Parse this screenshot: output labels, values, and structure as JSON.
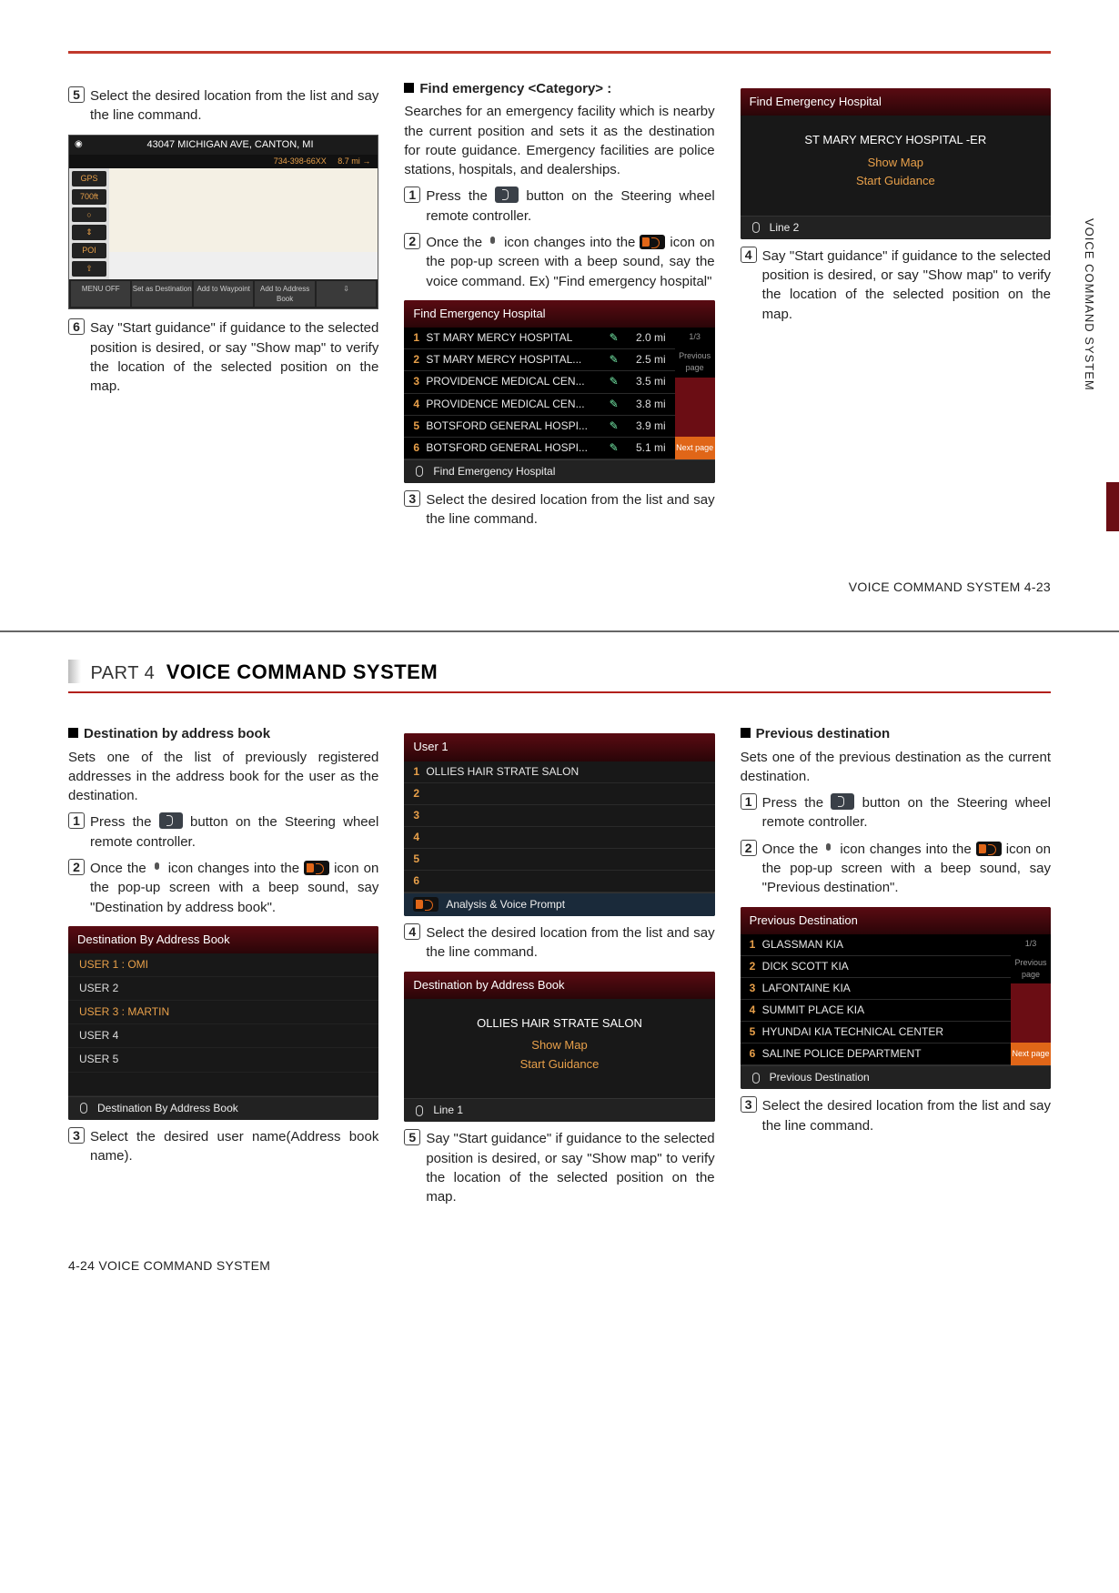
{
  "side_tab": "VOICE COMMAND SYSTEM",
  "p1": {
    "c1": {
      "step5": "Select the desired location from the list and say the line command.",
      "map": {
        "addr": "43047 MICHIGAN AVE, CANTON, MI",
        "phone": "734-398-66XX",
        "dist": "8.7 mi",
        "side": [
          "GPS",
          "700ft",
          "○",
          "⇕",
          "POI",
          "⇧"
        ],
        "bot": [
          "MENU OFF",
          "Set as Destination",
          "Add to Waypoint",
          "Add to Address Book",
          "⇩"
        ]
      },
      "step6": "Say \"Start guidance\" if guidance to the selected position is desired, or say \"Show map\" to verify the location of the selected position on the map."
    },
    "c2": {
      "heading": "Find emergency <Category> :",
      "intro": "Searches for an emergency facility which is nearby the current position and sets it as the destination for route guidance. Emergency facilities are police stations, hospitals, and dealerships.",
      "step1a": "Press the ",
      "step1b": " button on the Steering wheel remote controller.",
      "step2a": "Once the ",
      "step2b": " icon changes into the ",
      "step2c": " icon on the pop-up screen with a beep sound, say the voice command. Ex) \"Find emergency hospital\"",
      "dev1": {
        "title": "Find Emergency Hospital",
        "rows": [
          {
            "n": "1",
            "t": "ST MARY MERCY HOSPITAL",
            "d": "2.0 mi"
          },
          {
            "n": "2",
            "t": "ST MARY MERCY HOSPITAL...",
            "d": "2.5 mi"
          },
          {
            "n": "3",
            "t": "PROVIDENCE MEDICAL CEN...",
            "d": "3.5 mi"
          },
          {
            "n": "4",
            "t": "PROVIDENCE MEDICAL CEN...",
            "d": "3.8 mi"
          },
          {
            "n": "5",
            "t": "BOTSFORD GENERAL HOSPI...",
            "d": "3.9 mi"
          },
          {
            "n": "6",
            "t": "BOTSFORD GENERAL HOSPI...",
            "d": "5.1 mi"
          }
        ],
        "page_ind": "1/3",
        "prev": "Previous page",
        "next": "Next page",
        "foot": "Find Emergency Hospital"
      },
      "step3": "Select the desired location from the list and say the line command."
    },
    "c3": {
      "dev": {
        "title": "Find Emergency Hospital",
        "name": "ST MARY MERCY HOSPITAL -ER",
        "showmap": "Show Map",
        "start": "Start Guidance",
        "foot": "Line 2"
      },
      "step4": "Say \"Start guidance\" if guidance to the selected position is desired, or say \"Show map\" to verify the location of the selected position on the map."
    },
    "footer": "VOICE COMMAND SYSTEM   4-23"
  },
  "p2": {
    "part_label": "PART 4",
    "part_title": "VOICE COMMAND SYSTEM",
    "c1": {
      "heading": "Destination by address book",
      "intro": "Sets one of the list of previously registered addresses in the address book for the user as the destination.",
      "step1a": "Press the ",
      "step1b": " button on the Steering wheel remote controller.",
      "step2a": "Once the ",
      "step2b": " icon changes into the ",
      "step2c": " icon on the pop-up screen with a beep sound, say \"Destination by address book\".",
      "dev": {
        "title": "Destination By Address Book",
        "rows": [
          "USER 1 : OMI",
          "USER 2",
          "USER 3 : MARTIN",
          "USER 4",
          "USER 5"
        ],
        "foot": "Destination By Address Book"
      },
      "step3": "Select the desired user name(Address book name)."
    },
    "c2": {
      "dev1": {
        "title": "User 1",
        "rows": [
          {
            "n": "1",
            "t": "OLLIES HAIR STRATE SALON"
          },
          {
            "n": "2",
            "t": ""
          },
          {
            "n": "3",
            "t": ""
          },
          {
            "n": "4",
            "t": ""
          },
          {
            "n": "5",
            "t": ""
          },
          {
            "n": "6",
            "t": ""
          }
        ],
        "foot": "Analysis & Voice Prompt"
      },
      "step4": "Select the desired location from the list and say the line command.",
      "dev2": {
        "title": "Destination by Address Book",
        "name": "OLLIES HAIR STRATE SALON",
        "showmap": "Show Map",
        "start": "Start Guidance",
        "foot": "Line 1"
      },
      "step5": "Say \"Start guidance\" if guidance to the selected position is desired, or say \"Show map\" to verify the location of the selected position on the map."
    },
    "c3": {
      "heading": "Previous destination",
      "intro": "Sets one of the previous destination as the current destination.",
      "step1a": "Press the ",
      "step1b": " button on the Steering wheel remote controller.",
      "step2a": "Once the ",
      "step2b": " icon changes into the ",
      "step2c": " icon on the pop-up screen with a beep sound, say \"Previous destination\".",
      "dev": {
        "title": "Previous Destination",
        "rows": [
          {
            "n": "1",
            "t": "GLASSMAN KIA"
          },
          {
            "n": "2",
            "t": "DICK SCOTT KIA"
          },
          {
            "n": "3",
            "t": "LAFONTAINE KIA"
          },
          {
            "n": "4",
            "t": "SUMMIT PLACE KIA"
          },
          {
            "n": "5",
            "t": "HYUNDAI KIA TECHNICAL CENTER"
          },
          {
            "n": "6",
            "t": "SALINE POLICE DEPARTMENT"
          }
        ],
        "page_ind": "1/3",
        "prev": "Previous page",
        "next": "Next page",
        "foot": "Previous Destination"
      },
      "step3": "Select the desired location from the list and say the line command."
    },
    "footer": "4-24  VOICE COMMAND SYSTEM"
  }
}
